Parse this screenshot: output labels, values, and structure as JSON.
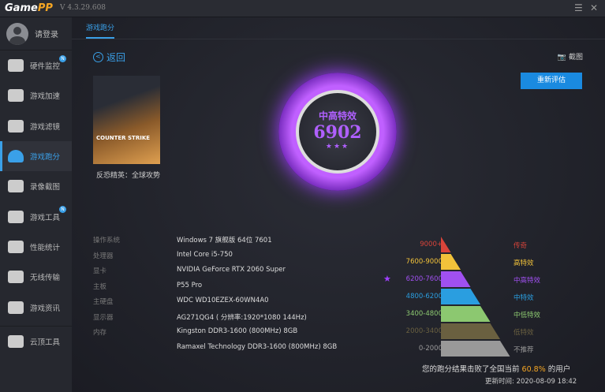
{
  "app": {
    "logo_a": "Game",
    "logo_b": "PP",
    "version": "V 4.3.29.608"
  },
  "sidebar": {
    "login": "请登录",
    "items": [
      {
        "label": "硬件监控",
        "badge": "N"
      },
      {
        "label": "游戏加速"
      },
      {
        "label": "游戏滤镜"
      },
      {
        "label": "游戏跑分",
        "active": true
      },
      {
        "label": "录像截图"
      },
      {
        "label": "游戏工具",
        "badge": "N"
      },
      {
        "label": "性能统计"
      },
      {
        "label": "无线传输"
      },
      {
        "label": "游戏资讯"
      },
      {
        "label": "云顶工具"
      }
    ]
  },
  "main": {
    "tab": "游戏跑分",
    "back": "返回",
    "screenshot": "截图",
    "retest": "重新评估",
    "game": {
      "cover_text": "COUNTER STRIKE",
      "name": "反恐精英：全球攻势"
    },
    "score": {
      "level": "中高特效",
      "value": "6902",
      "stars": "★★★"
    },
    "specs": [
      {
        "k": "操作系统",
        "v": "Windows 7 旗舰版 64位 7601"
      },
      {
        "k": "处理器",
        "v": "Intel Core i5-750"
      },
      {
        "k": "显卡",
        "v": "NVIDIA GeForce RTX 2060 Super"
      },
      {
        "k": "主板",
        "v": "P55 Pro"
      },
      {
        "k": "主硬盘",
        "v": "WDC WD10EZEX-60WN4A0"
      },
      {
        "k": "显示器",
        "v": "AG271QG4 ( 分辨率:1920*1080 144Hz)"
      },
      {
        "k": "内存",
        "v": "Kingston DDR3-1600 (800MHz) 8GB"
      },
      {
        "k": "",
        "v": "Ramaxel Technology DDR3-1600 (800MHz) 8GB"
      }
    ],
    "tiers": [
      {
        "range": "9000+",
        "name": "传奇",
        "color": "#d9443a"
      },
      {
        "range": "7600-9000",
        "name": "高特效",
        "color": "#f2c23a"
      },
      {
        "range": "6200-7600",
        "name": "中高特效",
        "color": "#a050f0",
        "current": true
      },
      {
        "range": "4800-6200",
        "name": "中特效",
        "color": "#2a9ee0"
      },
      {
        "range": "3400-4800",
        "name": "中低特效",
        "color": "#8cc870"
      },
      {
        "range": "2000-3400",
        "name": "低特效",
        "color": "#6a6040"
      },
      {
        "range": "0-2000",
        "name": "不推荐",
        "color": "#999999"
      }
    ],
    "result_pre": "您的跑分结果击败了全国当前",
    "result_pct": "60.8%",
    "result_post": "的用户",
    "update": "更新时间:  2020-08-09 18:42"
  }
}
